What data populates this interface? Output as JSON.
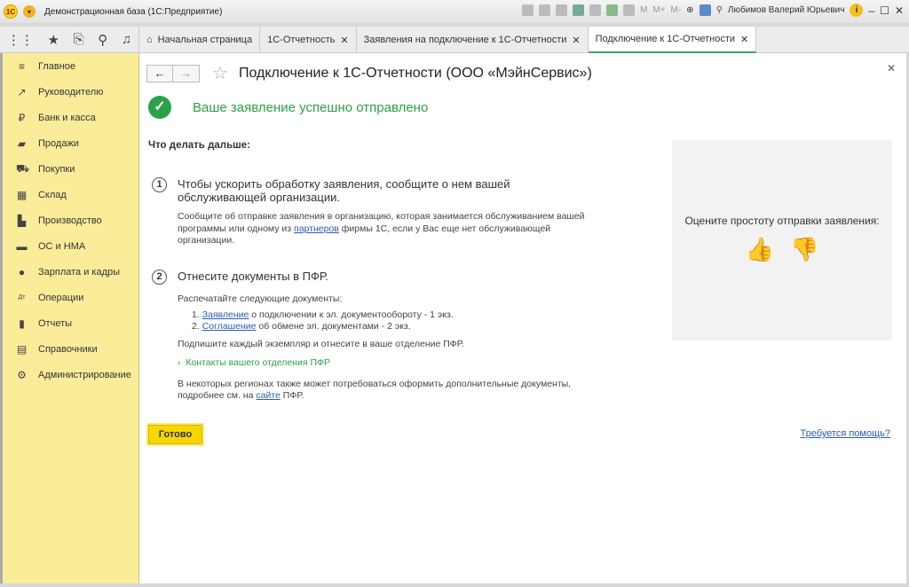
{
  "titlebar": {
    "logo": "1С",
    "title": "Демонстрационная база  (1С:Предприятие)",
    "memory": [
      "M",
      "M+",
      "M-"
    ],
    "user": "Любимов Валерий Юрьевич"
  },
  "tabs": [
    {
      "label": "Начальная страница"
    },
    {
      "label": "1С-Отчетность"
    },
    {
      "label": "Заявления на подключение к 1С-Отчетности"
    },
    {
      "label": "Подключение к 1С-Отчетности",
      "active": true
    }
  ],
  "sidebar": {
    "items": [
      {
        "label": "Главное",
        "icon": "menu-icon"
      },
      {
        "label": "Руководителю",
        "icon": "trend-icon"
      },
      {
        "label": "Банк и касса",
        "icon": "ruble-icon"
      },
      {
        "label": "Продажи",
        "icon": "bag-icon"
      },
      {
        "label": "Покупки",
        "icon": "cart-icon"
      },
      {
        "label": "Склад",
        "icon": "warehouse-icon"
      },
      {
        "label": "Производство",
        "icon": "factory-icon"
      },
      {
        "label": "ОС и НМА",
        "icon": "truck-icon"
      },
      {
        "label": "Зарплата и кадры",
        "icon": "person-icon"
      },
      {
        "label": "Операции",
        "icon": "dt-kt-icon"
      },
      {
        "label": "Отчеты",
        "icon": "bar-chart-icon"
      },
      {
        "label": "Справочники",
        "icon": "books-icon"
      },
      {
        "label": "Администрирование",
        "icon": "gear-icon"
      }
    ]
  },
  "main": {
    "title": "Подключение к 1С-Отчетности (ООО «МэйнСервис»)",
    "success": "Ваше заявление успешно отправлено",
    "next_heading": "Что делать дальше:",
    "step1": {
      "num": "1",
      "head": "Чтобы ускорить обработку заявления, сообщите о нем вашей обслуживающей организации.",
      "t1": "Сообщите об отправке заявления в организацию, которая занимается обслуживанием вашей программы или одному из ",
      "link": "партнеров",
      "t2": " фирмы 1С, если у Вас еще нет обслуживающей организации."
    },
    "step2": {
      "num": "2",
      "head": "Отнесите документы в ПФР.",
      "print": "Распечатайте следующие документы:",
      "l1n": "1. ",
      "l1link": "Заявление",
      "l1t": " о подключении к эл. документообороту - 1 экз.",
      "l2n": "2. ",
      "l2link": "Соглашение",
      "l2t": " об обмене эл. документами  - 2 экз.",
      "sign": "Подпишите каждый экземпляр и отнесите в ваше отделение ПФР.",
      "contacts": "Контакты вашего отделения ПФР",
      "extra1": "В некоторых регионах также может потребоваться оформить дополнительные документы, подробнее см. на ",
      "extralink": "сайте",
      "extra2": " ПФР."
    },
    "rating": "Оцените простоту отправки заявления:",
    "done": "Готово",
    "help": "Требуется помощь?"
  }
}
